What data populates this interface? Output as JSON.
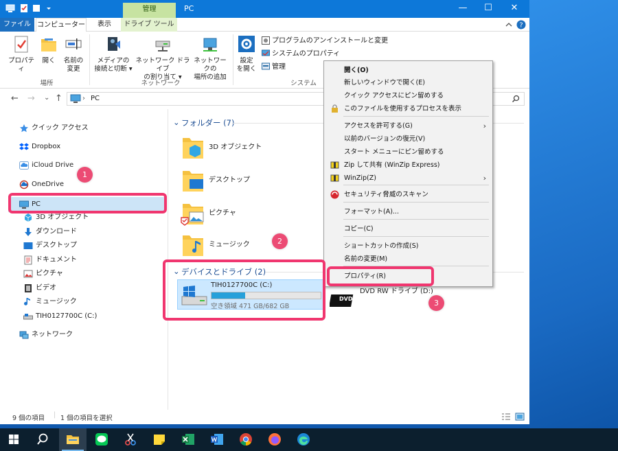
{
  "titlebar": {
    "contextual_tab": "管理",
    "title": "PC",
    "minimize": "—",
    "maximize": "☐",
    "close": "✕"
  },
  "ribbon_tabs": {
    "file": "ファイル",
    "computer": "コンピューター",
    "view": "表示",
    "drive_tools": "ドライブ ツール"
  },
  "ribbon": {
    "location": {
      "group_label": "場所",
      "properties": "プロパティ",
      "open": "開く",
      "rename_line1": "名前の",
      "rename_line2": "変更"
    },
    "network": {
      "group_label": "ネットワーク",
      "media_line1": "メディアの",
      "media_line2": "接続と切断 ▾",
      "mapdrive_line1": "ネットワーク ドライブ",
      "mapdrive_line2": "の割り当て ▾",
      "addloc_line1": "ネットワークの",
      "addloc_line2": "場所の追加"
    },
    "system": {
      "group_label": "システム",
      "settings_line1": "設定",
      "settings_line2": "を開く",
      "uninstall": "プログラムのアンインストールと変更",
      "sysprops": "システムのプロパティ",
      "manage": "管理"
    }
  },
  "address": {
    "back": "←",
    "forward": "→",
    "recent": "⌄",
    "up": "↑",
    "path": "PC",
    "separator": "›"
  },
  "navpane": {
    "items": [
      {
        "label": "クイック アクセス"
      },
      {
        "label": "Dropbox"
      },
      {
        "label": "iCloud Drive"
      },
      {
        "label": "OneDrive"
      },
      {
        "label": "PC"
      },
      {
        "label": "3D オブジェクト"
      },
      {
        "label": "ダウンロード"
      },
      {
        "label": "デスクトップ"
      },
      {
        "label": "ドキュメント"
      },
      {
        "label": "ピクチャ"
      },
      {
        "label": "ビデオ"
      },
      {
        "label": "ミュージック"
      },
      {
        "label": "TIH0127700C (C:)"
      },
      {
        "label": "ネットワーク"
      }
    ]
  },
  "content": {
    "folders_header": "フォルダー (7)",
    "folders": [
      {
        "label": "3D オブジェクト"
      },
      {
        "label": "デスクトップ"
      },
      {
        "label": "ピクチャ"
      },
      {
        "label": "ミュージック"
      }
    ],
    "devices_header": "デバイスとドライブ (2)",
    "drive_c": {
      "name": "TIH0127700C (C:)",
      "free_text": "空き領域 471 GB/682 GB",
      "used_fraction": 0.31
    },
    "dvd_label": "DVD RW ドライブ (D:)",
    "dvd_badge": "DVD"
  },
  "context_menu": {
    "items": [
      {
        "label": "開く(O)",
        "bold": true
      },
      {
        "label": "新しいウィンドウで開く(E)"
      },
      {
        "label": "クイック アクセスにピン留めする"
      },
      {
        "label": "このファイルを使用するプロセスを表示"
      },
      {
        "label": "アクセスを許可する(G)"
      },
      {
        "label": "以前のバージョンの復元(V)"
      },
      {
        "label": "スタート メニューにピン留めする"
      },
      {
        "label": "Zip して共有 (WinZip Express)"
      },
      {
        "label": "WinZip(Z)"
      },
      {
        "label": "セキュリティ脅威のスキャン"
      },
      {
        "label": "フォーマット(A)..."
      },
      {
        "label": "コピー(C)"
      },
      {
        "label": "ショートカットの作成(S)"
      },
      {
        "label": "名前の変更(M)"
      },
      {
        "label": "プロパティ(R)"
      }
    ],
    "submenu_arrow": "›"
  },
  "statusbar": {
    "item_count": "9 個の項目",
    "selected": "1 個の項目を選択"
  },
  "annotations": [
    "1",
    "2",
    "3"
  ],
  "taskbar": {
    "apps": [
      "start-icon",
      "search-icon",
      "file-explorer-icon",
      "line-icon",
      "snipping-icon",
      "sticky-notes-icon",
      "excel-icon",
      "word-icon",
      "chrome-icon",
      "firefox-icon",
      "edge-icon"
    ]
  },
  "colors": {
    "accent": "#0d78d9",
    "selection": "#cce8ff",
    "annotation": "#f0366f"
  }
}
